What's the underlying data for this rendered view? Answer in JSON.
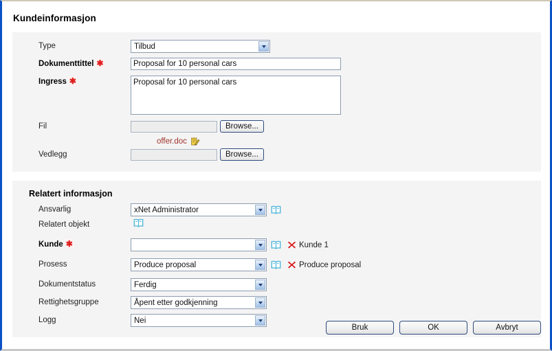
{
  "page": {
    "title": "Kundeinformasjon"
  },
  "customer_section": {
    "fields": {
      "type": {
        "label": "Type",
        "value": "Tilbud"
      },
      "document_title": {
        "label": "Dokumenttittel",
        "required_marker": "✱",
        "value": "Proposal for 10 personal cars"
      },
      "ingress": {
        "label": "Ingress",
        "required_marker": "✱",
        "value": "Proposal for 10 personal cars"
      },
      "file": {
        "label": "Fil",
        "value": "",
        "browse_label": "Browse..."
      },
      "attachment": {
        "label": "Vedlegg",
        "value": "",
        "browse_label": "Browse..."
      }
    },
    "uploaded_file": {
      "name": "offer.doc",
      "edit_icon": "edit-document-icon"
    }
  },
  "related_section": {
    "title": "Relatert informasjon",
    "fields": {
      "responsible": {
        "label": "Ansvarlig",
        "value": "xNet Administrator",
        "book_icon": "book-icon"
      },
      "related_object": {
        "label": "Relatert objekt",
        "book_icon": "book-icon"
      },
      "customer": {
        "label": "Kunde",
        "required_marker": "✱",
        "value": "",
        "book_icon": "book-icon",
        "remove_icon": "remove-x-icon",
        "linked_item": "Kunde 1"
      },
      "process": {
        "label": "Prosess",
        "value": "Produce proposal",
        "book_icon": "book-icon",
        "remove_icon": "remove-x-icon",
        "linked_item": "Produce proposal"
      },
      "document_status": {
        "label": "Dokumentstatus",
        "value": "Ferdig"
      },
      "rights_group": {
        "label": "Rettighetsgruppe",
        "value": "Åpent etter godkjenning"
      },
      "log": {
        "label": "Logg",
        "value": "Nei"
      }
    }
  },
  "footer": {
    "apply_label": "Bruk",
    "ok_label": "OK",
    "cancel_label": "Avbryt"
  },
  "colors": {
    "frame_blue": "#0b51c5",
    "panel_gray": "#f4f4f4",
    "required_red": "#e02020",
    "file_link": "#a0342c",
    "book_icon": "#4ab4d8",
    "remove_x": "#d81414"
  }
}
